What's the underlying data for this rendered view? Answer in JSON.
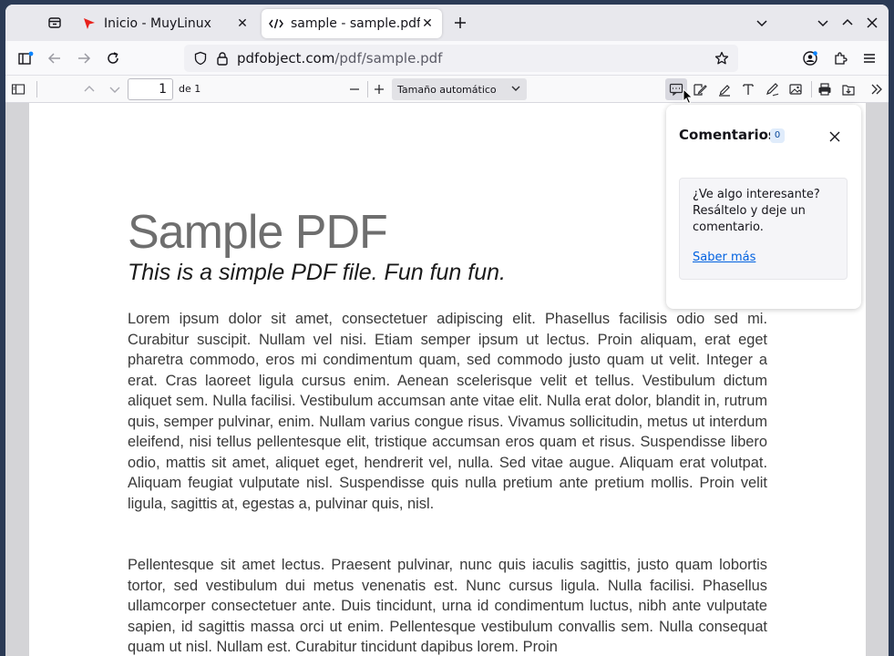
{
  "tabs": [
    {
      "title": "Inicio - MuyLinux",
      "icon": "muylinux-favicon",
      "active": false
    },
    {
      "title": "sample - sample.pdf",
      "icon": "code-icon",
      "active": true
    }
  ],
  "navbar": {
    "url_domain": "pdfobject.com",
    "url_path": "/pdf/sample.pdf"
  },
  "pdf_toolbar": {
    "page_number": "1",
    "page_of": "de 1",
    "zoom": "Tamaño automático"
  },
  "document": {
    "title": "Sample PDF",
    "subtitle": "This is a simple PDF file. Fun fun fun.",
    "paragraph1": "Lorem ipsum dolor sit amet, consectetuer adipiscing elit. Phasellus facilisis odio sed mi. Curabitur suscipit. Nullam vel nisi. Etiam semper ipsum ut lectus. Proin aliquam, erat eget pharetra commodo, eros mi condimentum quam, sed commodo justo quam ut velit. Integer a erat. Cras laoreet ligula cursus enim. Aenean scelerisque velit et tellus. Vestibulum dictum aliquet sem. Nulla facilisi. Vestibulum accumsan ante vitae elit. Nulla erat dolor, blandit in, rutrum quis, semper pulvinar, enim. Nullam varius congue risus. Vivamus sollicitudin, metus ut interdum eleifend, nisi tellus pellentesque elit, tristique accumsan eros quam et risus. Suspendisse libero odio, mattis sit amet, aliquet eget, hendrerit vel, nulla. Sed vitae augue. Aliquam erat volutpat. Aliquam feugiat vulputate nisl. Suspendisse quis nulla pretium ante pretium mollis. Proin velit ligula, sagittis at, egestas a, pulvinar quis, nisl.",
    "paragraph2": "Pellentesque sit amet lectus. Praesent pulvinar, nunc quis iaculis sagittis, justo quam lobortis tortor, sed vestibulum dui metus venenatis est. Nunc cursus ligula. Nulla facilisi. Phasellus ullamcorper consectetuer ante. Duis tincidunt, urna id condimentum luctus, nibh ante vulputate sapien, id sagittis massa orci ut enim. Pellentesque vestibulum convallis sem. Nulla consequat quam ut nisl. Nullam est. Curabitur tincidunt dapibus lorem. Proin"
  },
  "comments_popup": {
    "title": "Comentarios",
    "count": "0",
    "message": "¿Ve algo interesante? Resáltelo y deje un comentario.",
    "link": "Saber más"
  },
  "colors": {
    "accent_link": "#0061e0",
    "muylinux_red": "#e8211c"
  }
}
